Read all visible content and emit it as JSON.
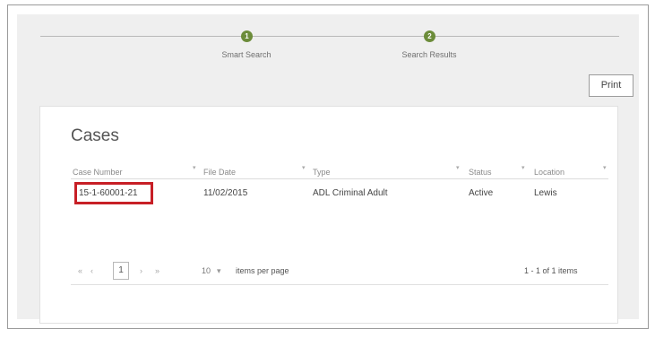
{
  "steps": [
    {
      "number": "1",
      "label": "Smart Search"
    },
    {
      "number": "2",
      "label": "Search Results"
    }
  ],
  "print_label": "Print",
  "cases": {
    "title": "Cases",
    "columns": [
      "Case Number",
      "File Date",
      "Type",
      "Status",
      "Location"
    ],
    "rows": [
      {
        "case_number": "15-1-60001-21",
        "file_date": "11/02/2015",
        "type": "ADL Criminal Adult",
        "status": "Active",
        "location": "Lewis"
      }
    ]
  },
  "pager": {
    "first": "«",
    "prev": "‹",
    "current_page": "1",
    "next": "›",
    "last": "»",
    "page_size": "10",
    "items_per_page_label": "items per page",
    "summary": "1 - 1 of 1 items"
  },
  "colors": {
    "step_active": "#6c8c3a",
    "highlight": "#c71f26"
  }
}
